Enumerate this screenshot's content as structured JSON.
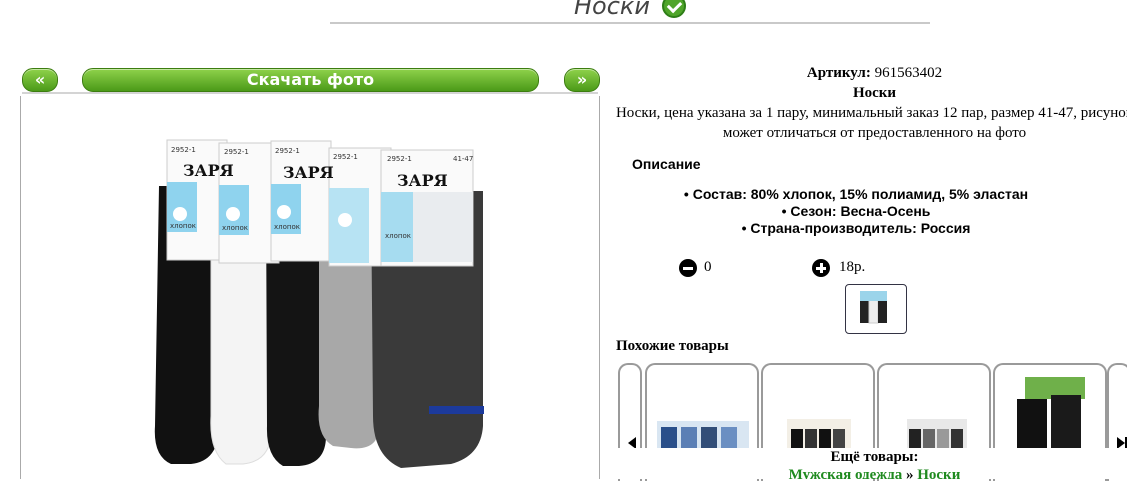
{
  "page": {
    "title": "Носки"
  },
  "gallery": {
    "prev_label": "«",
    "next_label": "»",
    "download_label": "Скачать фото",
    "tag_code": "2952-1",
    "tag_size": "41-47",
    "brand": "ЗАРЯ",
    "tag_cotton": "хлопок"
  },
  "product": {
    "sku_label": "Артикул:",
    "sku": "961563402",
    "name": "Носки",
    "description": "Носки, цена указана за 1 пару, минимальный заказ 12 пар, размер 41-47, рисунок может отличаться от предоставленного на фото",
    "desc_heading": "Описание",
    "specs": [
      "Состав: 80% хлопок, 15% полиамид, 5% эластан",
      "Сезон: Весна-Осень",
      "Страна-производитель: Россия"
    ],
    "quantity": "0",
    "price": "18р."
  },
  "similar": {
    "heading": "Похожие товары"
  },
  "more": {
    "heading": "Ещё товары:",
    "crumb_category": "Мужская одежда",
    "crumb_sep": "»",
    "crumb_item": "Носки"
  },
  "colors": {
    "accent_green": "#5aab24",
    "link_green": "#1f8a1f"
  }
}
